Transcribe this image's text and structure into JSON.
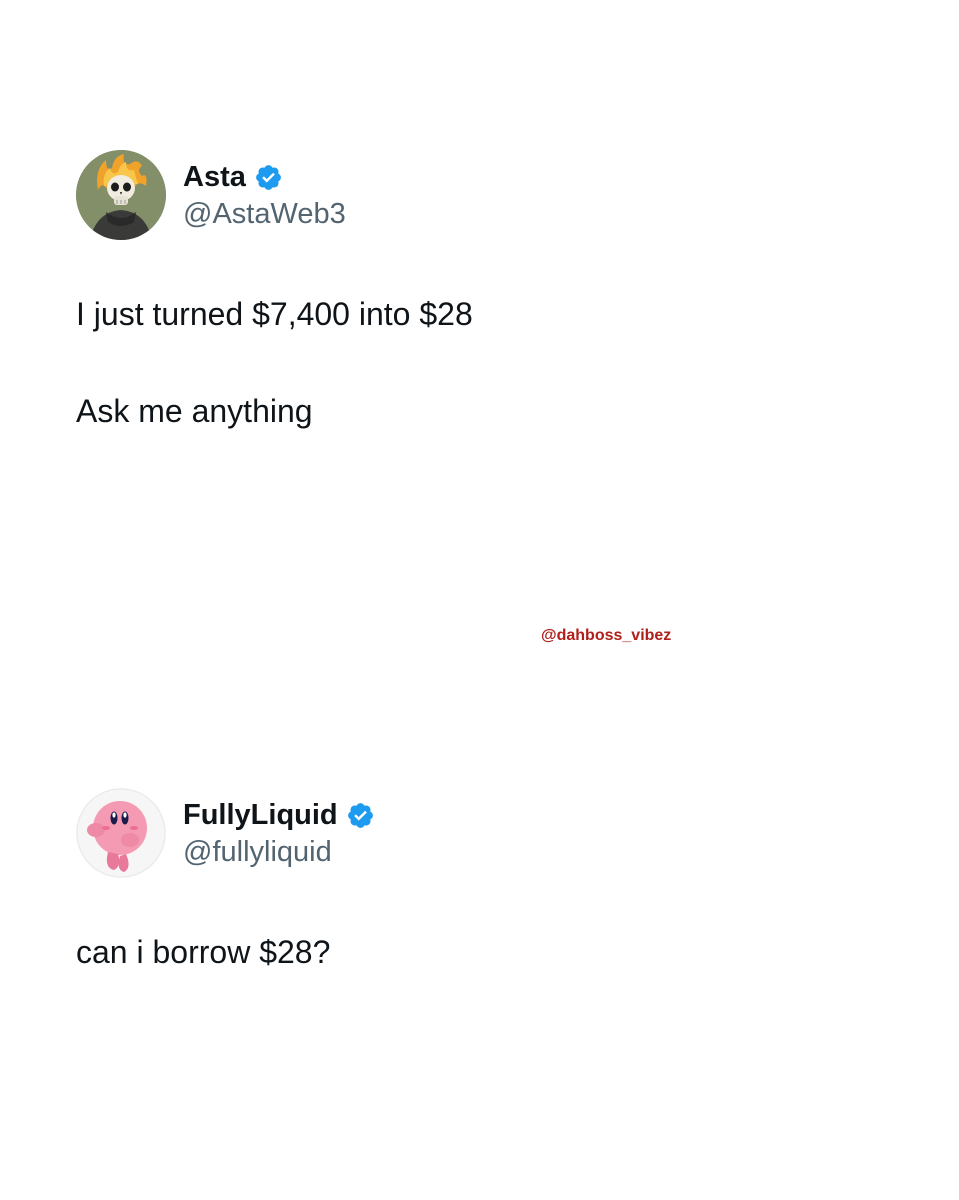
{
  "tweets": [
    {
      "display_name": "Asta",
      "handle": "@AstaWeb3",
      "verified": true,
      "avatar_icon": "flaming-skull-avatar",
      "lines": [
        "I just turned $7,400 into $28",
        "Ask me anything"
      ]
    },
    {
      "display_name": "FullyLiquid",
      "handle": "@fullyliquid",
      "verified": true,
      "avatar_icon": "pink-puffball-avatar",
      "lines": [
        "can i borrow $28?"
      ]
    }
  ],
  "watermark": "@dahboss_vibez",
  "colors": {
    "verified_blue": "#1d9bf0",
    "text": "#0f1419",
    "handle": "#536471",
    "watermark": "#b0201a"
  }
}
